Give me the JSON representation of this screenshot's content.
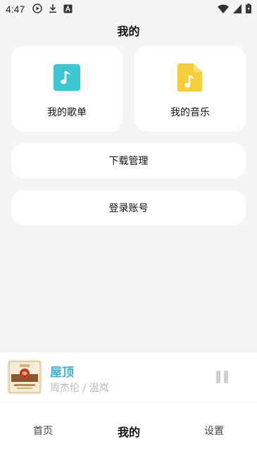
{
  "status_bar": {
    "time": "4:47",
    "left_icons": [
      "play-circle-icon",
      "download-icon",
      "text-a-icon"
    ],
    "right_icons": [
      "wifi-icon",
      "signal-icon",
      "battery-icon"
    ]
  },
  "header": {
    "title": "我的"
  },
  "cards": {
    "playlist": {
      "label": "我的歌单",
      "icon": "music-note-icon",
      "color": "#3ec6d3"
    },
    "music": {
      "label": "我的音乐",
      "icon": "music-file-icon",
      "color": "#f5cf3b"
    },
    "downloads": {
      "label": "下载管理"
    },
    "login": {
      "label": "登录账号"
    }
  },
  "player": {
    "title": "屋顶",
    "artist": "周杰伦 / 温岚",
    "accent": "#3fb0d6",
    "control": "pause-icon"
  },
  "tabs": [
    {
      "label": "首页",
      "active": false
    },
    {
      "label": "我的",
      "active": true
    },
    {
      "label": "设置",
      "active": false
    }
  ]
}
